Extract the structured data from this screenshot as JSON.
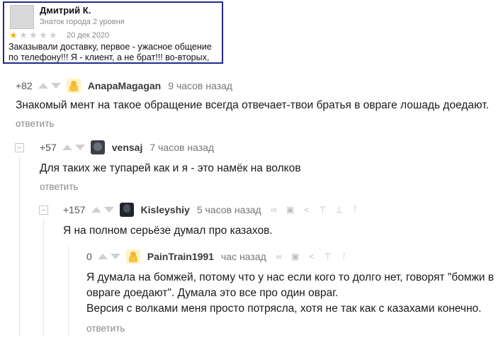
{
  "review": {
    "author": "Дмитрий К.",
    "level": "Знаток города 2 уровня",
    "stars": "★☆☆☆☆",
    "date": "20 дек 2020",
    "text_line1": "Заказывали доставку, первое - ужасное общение",
    "text_line2": "по телефону!!! Я - клиент, а не брат!!! во-вторых,"
  },
  "comments": [
    {
      "rating": "+82",
      "user": "AnapaMagagan",
      "time": "9 часов назад",
      "text": "Знакомый мент на такое обращение всегда отвечает-твои братья в овраге лошадь доедают.",
      "reply": "ответить"
    },
    {
      "rating": "+57",
      "user": "vensaj",
      "time": "7 часов назад",
      "text": "Для таких же тупарей как и я - это намёк на волков",
      "reply": "ответить"
    },
    {
      "rating": "+157",
      "user": "Kisleyshiy",
      "time": "5 часов назад",
      "text": "Я на полном серьёзе думал про казахов."
    },
    {
      "rating": "0",
      "user": "PainTrain1991",
      "time": "час назад",
      "text_line1": "Я думала на бомжей, потому что у нас если кого то долго нет, говорят \"бомжи в",
      "text_line2": "овраге доедают\". Думала это все про один овраг.",
      "text_line3": "Версия с волками меня просто потрясла, хотя не так как с казахами конечно.",
      "reply": "ответить"
    }
  ],
  "icons": {
    "link": "🔗",
    "save": "💾",
    "share": "<",
    "up": "⤒",
    "down": "⤓",
    "tag": "ᐃ"
  }
}
